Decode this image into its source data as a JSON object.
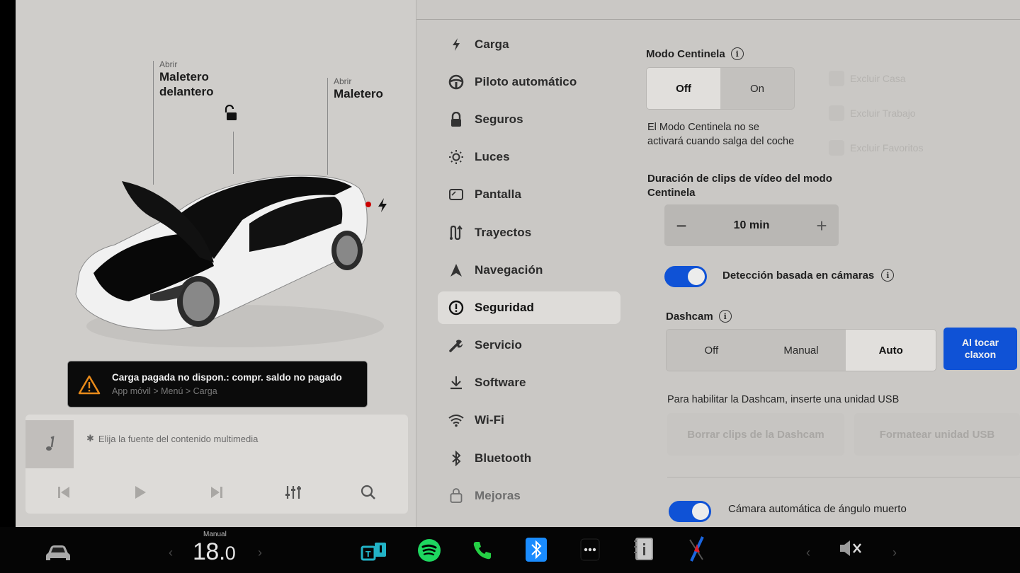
{
  "left_panel": {
    "frunk": {
      "action": "Abrir",
      "label": "Maletero delantero",
      "label_line1": "Maletero",
      "label_line2": "delantero"
    },
    "trunk": {
      "action": "Abrir",
      "label": "Maletero"
    },
    "icons": {
      "lock": "unlock-icon",
      "charge_port": "lightning-bolt-icon"
    },
    "alert": {
      "icon": "warning-icon",
      "title": "Carga pagada no dispon.: compr. saldo no pagado",
      "subtitle": "App móvil > Menú > Carga",
      "icon_color": "#e88a1a"
    },
    "media": {
      "source_text": "Elija la fuente del contenido multimedia",
      "source_icon": "bluetooth-icon",
      "art_icon": "music-note-icon",
      "controls": [
        "previous-icon",
        "play-icon",
        "next-icon",
        "equalizer-icon",
        "search-icon"
      ]
    }
  },
  "nav": {
    "items": [
      {
        "label": "Carga",
        "icon": "lightning-icon"
      },
      {
        "label": "Piloto automático",
        "icon": "steering-wheel-icon"
      },
      {
        "label": "Seguros",
        "icon": "lock-icon"
      },
      {
        "label": "Luces",
        "icon": "sun-icon"
      },
      {
        "label": "Pantalla",
        "icon": "display-icon"
      },
      {
        "label": "Trayectos",
        "icon": "trips-icon"
      },
      {
        "label": "Navegación",
        "icon": "navigation-arrow-icon"
      },
      {
        "label": "Seguridad",
        "icon": "alert-circle-icon",
        "active": true
      },
      {
        "label": "Servicio",
        "icon": "wrench-icon"
      },
      {
        "label": "Software",
        "icon": "download-icon"
      },
      {
        "label": "Wi-Fi",
        "icon": "wifi-icon"
      },
      {
        "label": "Bluetooth",
        "icon": "bluetooth-icon"
      },
      {
        "label": "Mejoras",
        "icon": "shopping-bag-icon"
      }
    ]
  },
  "security": {
    "sentry": {
      "title": "Modo Centinela",
      "options": [
        "Off",
        "On"
      ],
      "selected": "Off",
      "description": "El Modo Centinela no se activará cuando salga del coche",
      "exclusions": [
        "Excluir Casa",
        "Excluir Trabajo",
        "Excluir Favoritos"
      ]
    },
    "clip_duration": {
      "title": "Duración de clips de vídeo del modo Centinela",
      "value": "10 min",
      "minus": "−",
      "plus": "+"
    },
    "camera_detection": {
      "label": "Detección basada en cámaras",
      "enabled": true
    },
    "dashcam": {
      "title": "Dashcam",
      "options": [
        "Off",
        "Manual",
        "Auto"
      ],
      "selected": "Auto",
      "horn_button": "Al tocar claxon",
      "horn_line1": "Al tocar",
      "horn_line2": "claxon",
      "usb_note": "Para habilitar la Dashcam, inserte una unidad USB",
      "delete_button": "Borrar clips de la Dashcam",
      "format_button": "Formatear unidad USB"
    },
    "blind_spot": {
      "label": "Cámara automática de ángulo muerto",
      "enabled": true
    },
    "accent_color": "#0f52d6"
  },
  "taskbar": {
    "climate_mode": "Manual",
    "temperature": "18.0",
    "temp_int": "18.",
    "temp_dec": "0",
    "icons": [
      "car-icon",
      "toybox-icon",
      "spotify-icon",
      "phone-icon",
      "bluetooth-icon",
      "more-icon",
      "manual-icon",
      "camera-nav-icon",
      "volume-muted-icon"
    ]
  }
}
